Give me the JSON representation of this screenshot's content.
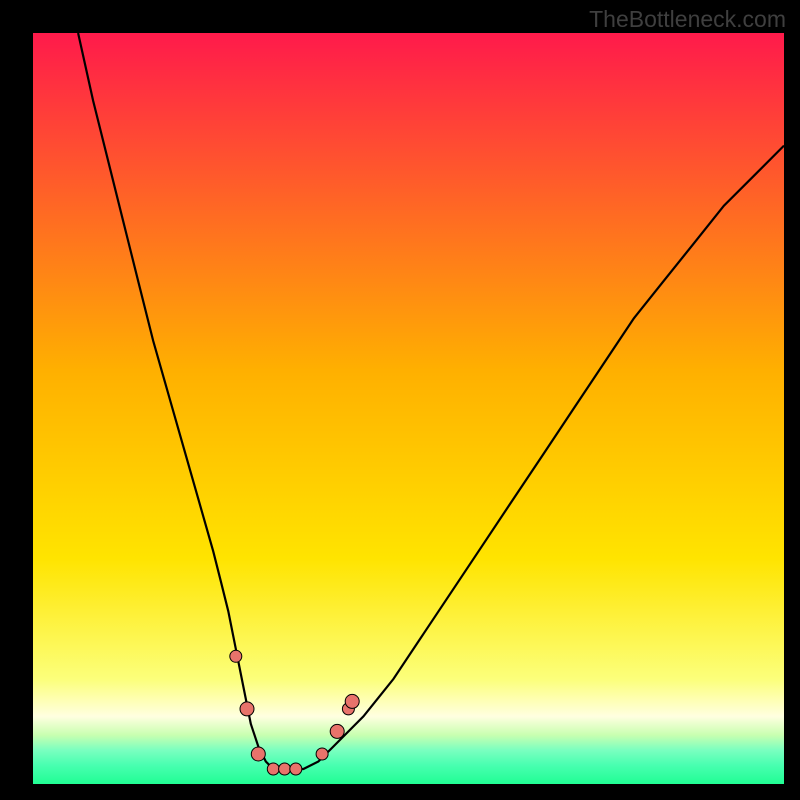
{
  "watermark": "TheBottleneck.com",
  "colors": {
    "black": "#000000",
    "curve": "#000000",
    "marker_fill": "#e8736b",
    "marker_stroke": "#000000",
    "grad_top": "#ff1a4b",
    "grad_mid": "#ffd400",
    "grad_pale": "#ffffd0",
    "grad_thinA": "#6dff88",
    "grad_thinB": "#4dffa0",
    "grad_thinC": "#35ffb8",
    "grad_bottom": "#21fe94"
  },
  "chart_data": {
    "type": "line",
    "title": "",
    "xlabel": "",
    "ylabel": "",
    "xlim": [
      0,
      100
    ],
    "ylim": [
      0,
      100
    ],
    "series": [
      {
        "name": "curve",
        "x": [
          6,
          8,
          10,
          12,
          14,
          16,
          18,
          20,
          22,
          24,
          25,
          26,
          27,
          28,
          29,
          30,
          31,
          32,
          33,
          34,
          36,
          38,
          40,
          44,
          48,
          52,
          56,
          60,
          64,
          68,
          72,
          76,
          80,
          84,
          88,
          92,
          96,
          100
        ],
        "values": [
          100,
          91,
          83,
          75,
          67,
          59,
          52,
          45,
          38,
          31,
          27,
          23,
          18,
          13,
          8,
          5,
          3,
          2,
          2,
          2,
          2,
          3,
          5,
          9,
          14,
          20,
          26,
          32,
          38,
          44,
          50,
          56,
          62,
          67,
          72,
          77,
          81,
          85
        ]
      }
    ],
    "markers": [
      {
        "x": 27.0,
        "y": 17,
        "r": 6
      },
      {
        "x": 28.5,
        "y": 10,
        "r": 7
      },
      {
        "x": 30.0,
        "y": 4,
        "r": 7
      },
      {
        "x": 32.0,
        "y": 2,
        "r": 6
      },
      {
        "x": 33.5,
        "y": 2,
        "r": 6
      },
      {
        "x": 35.0,
        "y": 2,
        "r": 6
      },
      {
        "x": 38.5,
        "y": 4,
        "r": 6
      },
      {
        "x": 40.5,
        "y": 7,
        "r": 7
      },
      {
        "x": 42.0,
        "y": 10,
        "r": 6
      },
      {
        "x": 42.5,
        "y": 11,
        "r": 7
      }
    ]
  }
}
